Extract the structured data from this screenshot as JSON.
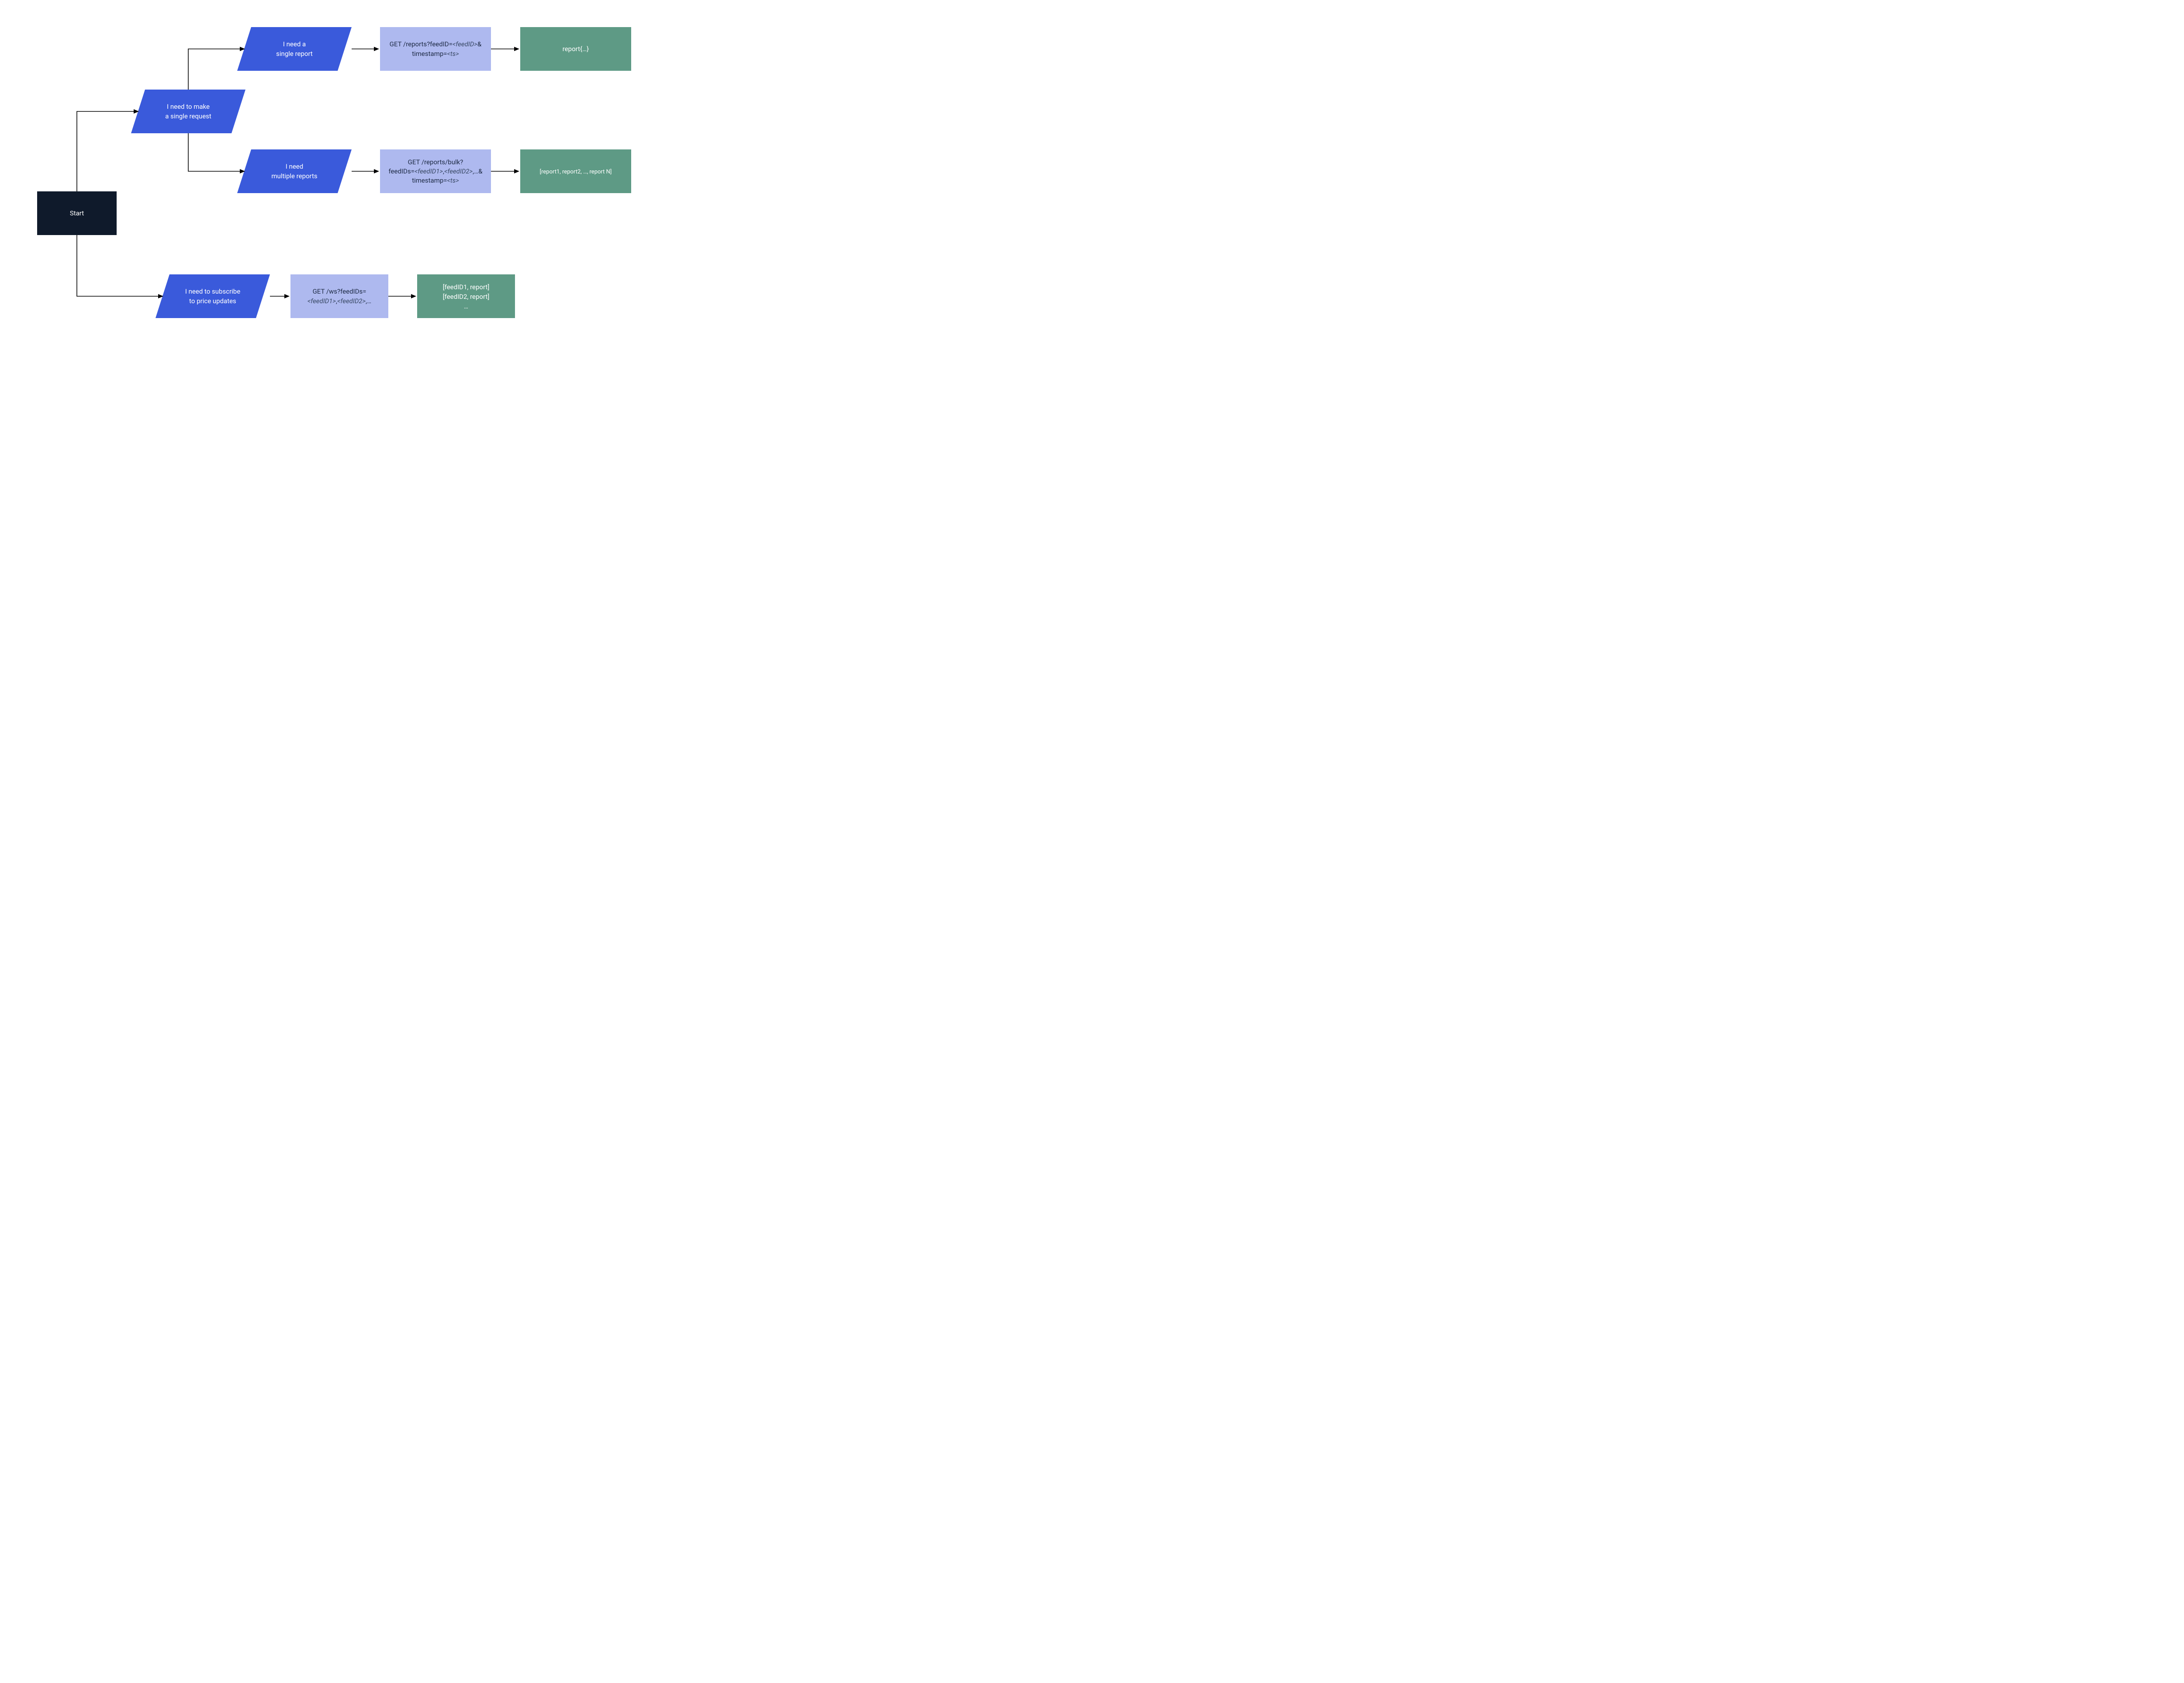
{
  "start": {
    "label": "Start"
  },
  "decisions": {
    "single_request": {
      "line1": "I need to make",
      "line2": "a single request"
    },
    "single_report": {
      "line1": "I need a",
      "line2": "single report"
    },
    "multiple_reports": {
      "line1": "I need",
      "line2": "multiple reports"
    },
    "subscribe": {
      "line1": "I need to subscribe",
      "line2": "to price updates"
    }
  },
  "api": {
    "single": {
      "pre1": "GET /reports?feedID=",
      "param1": "<feedID>",
      "post1": "&",
      "pre2": "timestamp=",
      "param2": "<ts>"
    },
    "bulk": {
      "line1": "GET /reports/bulk?",
      "pre2": "feedIDs=",
      "param2a": "<feedID1>",
      "sep2": ",",
      "param2b": "<feedID2>",
      "post2": ",…&",
      "pre3": "timestamp=",
      "param3": "<ts>"
    },
    "ws": {
      "line1": "GET /ws?feedIDs=",
      "param2a": "<feedID1>",
      "sep2": ",",
      "param2b": "<feedID2>",
      "post2": ",…"
    }
  },
  "results": {
    "single": "report{…}",
    "bulk": "[report1, report2, …, report N]",
    "ws_line1": "[feedID1, report]",
    "ws_line2": "[feedID2, report]",
    "ws_line3": "…"
  }
}
